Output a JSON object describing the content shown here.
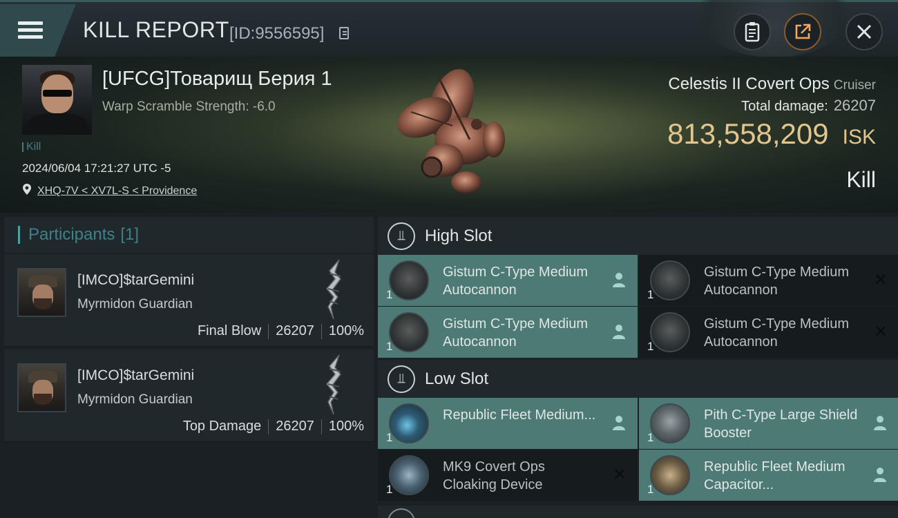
{
  "header": {
    "title": "KILL REPORT",
    "report_id": "[ID:9556595]"
  },
  "victim": {
    "name": "[UFCG]Товарищ Берия 1",
    "warp_scramble": "Warp Scramble Strength: -6.0",
    "kill_tag": "Kill",
    "timestamp": "2024/06/04 17:21:27 UTC -5",
    "location": "XHQ-7V < XV7L-S < Providence"
  },
  "ship": {
    "name": "Celestis II Covert Ops",
    "class": "Cruiser",
    "damage_label": "Total damage:",
    "damage_value": "26207",
    "isk_value": "813,558,209",
    "isk_unit": "ISK",
    "result": "Kill"
  },
  "participants": {
    "label": "Participants",
    "count": "[1]",
    "items": [
      {
        "name": "[IMCO]$tarGemini",
        "ship": "Myrmidon Guardian",
        "role": "Final Blow",
        "damage": "26207",
        "percent": "100%"
      },
      {
        "name": "[IMCO]$tarGemini",
        "ship": "Myrmidon Guardian",
        "role": "Top Damage",
        "damage": "26207",
        "percent": "100%"
      }
    ]
  },
  "fitting": {
    "high_slot": {
      "label": "High Slot",
      "modules": [
        {
          "name": "Gistum C-Type Medium Autocannon",
          "qty": "1",
          "state": "fitted",
          "icon": "autocannon-icon"
        },
        {
          "name": "Gistum C-Type Medium Autocannon",
          "qty": "1",
          "state": "destroyed",
          "icon": "autocannon-icon"
        },
        {
          "name": "Gistum C-Type Medium Autocannon",
          "qty": "1",
          "state": "fitted",
          "icon": "autocannon-icon"
        },
        {
          "name": "Gistum C-Type Medium Autocannon",
          "qty": "1",
          "state": "destroyed",
          "icon": "autocannon-icon"
        }
      ]
    },
    "low_slot": {
      "label": "Low Slot",
      "modules": [
        {
          "name": "Republic Fleet Medium...",
          "qty": "1",
          "state": "fitted",
          "icon": "booster-icon"
        },
        {
          "name": "Pith C-Type Large Shield Booster",
          "qty": "1",
          "state": "fitted",
          "icon": "shield-icon"
        },
        {
          "name": "MK9 Covert Ops Cloaking Device",
          "qty": "1",
          "state": "destroyed",
          "icon": "cloak-icon"
        },
        {
          "name": "Republic Fleet Medium Capacitor...",
          "qty": "1",
          "state": "fitted",
          "icon": "capacitor-icon"
        }
      ]
    }
  },
  "colors": {
    "accent_teal": "#4e7a76",
    "isk_gold": "#e2c58f",
    "participants_accent": "#47a3a8"
  }
}
